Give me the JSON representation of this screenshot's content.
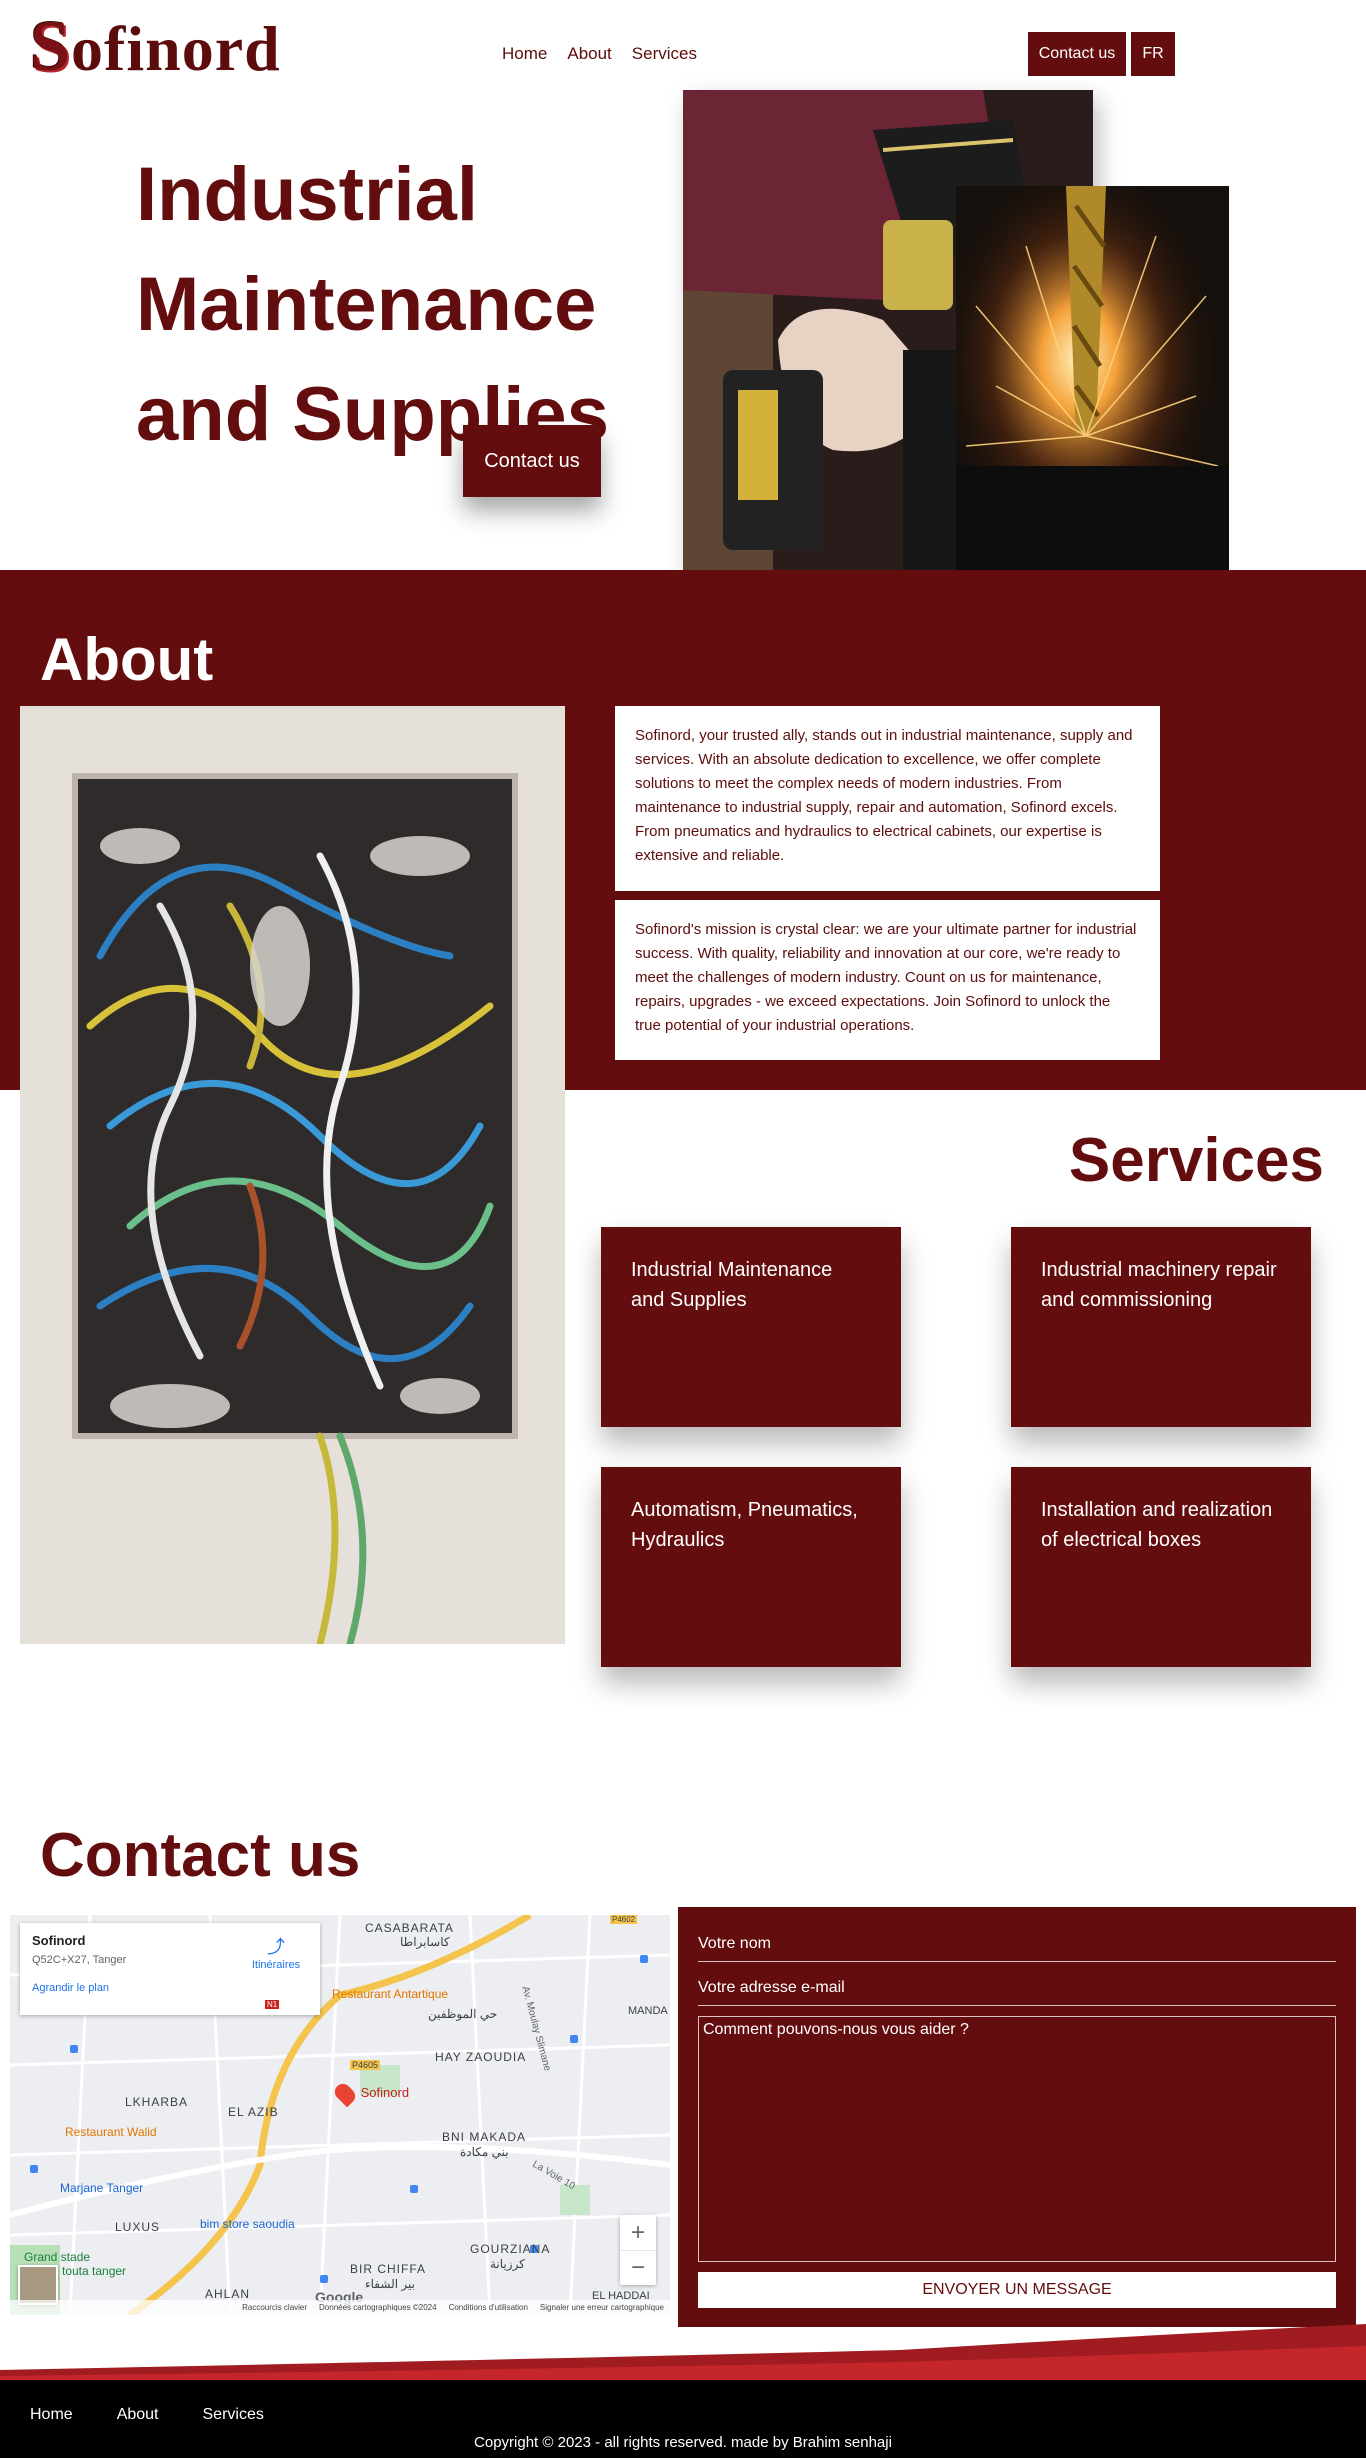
{
  "header": {
    "logo_initial": "S",
    "logo_rest": "ofinord",
    "nav": [
      "Home",
      "About",
      "Services"
    ],
    "contact_button": "Contact us",
    "language_button": "FR"
  },
  "hero": {
    "title_lines": [
      "Industrial",
      "Maintenance",
      "and Supplies"
    ],
    "cta": "Contact us"
  },
  "about": {
    "title": "About",
    "paragraphs": [
      "Sofinord, your trusted ally, stands out in industrial maintenance, supply and services. With an absolute dedication to excellence, we offer complete solutions to meet the complex needs of modern industries. From maintenance to industrial supply, repair and automation, Sofinord excels. From pneumatics and hydraulics to electrical cabinets, our expertise is extensive and reliable.",
      "Sofinord's mission is crystal clear: we are your ultimate partner for industrial success. With quality, reliability and innovation at our core, we're ready to meet the challenges of modern industry. Count on us for maintenance, repairs, upgrades - we exceed expectations. Join Sofinord to unlock the true potential of your industrial operations."
    ]
  },
  "services": {
    "title": "Services",
    "items": [
      "Industrial Maintenance and Supplies",
      "Industrial machinery repair and commissioning",
      "Automatism, Pneumatics, Hydraulics",
      "Installation and realization of electrical boxes"
    ]
  },
  "contact": {
    "title": "Contact us",
    "map": {
      "place_name": "Sofinord",
      "address": "Q52C+X27, Tanger",
      "directions": "Itinéraires",
      "enlarge": "Agrandir le plan",
      "marker_label": "Sofinord",
      "labels": [
        "CASABARATA",
        "كاسابراطا",
        "Restaurant Antartique",
        "حي الموظفين",
        "HAY ZAOUDIA",
        "P4605",
        "LKHARBA",
        "EL AZIB",
        "BNI MAKADA",
        "بني مكادة",
        "Restaurant Walid",
        "Marjane Tanger",
        "LUXUS",
        "bim store saoudia",
        "GOURZIANA",
        "كرزيانة",
        "BIR CHIFFA",
        "بير الشفاء",
        "AHLAN",
        "Grand stade",
        "touta tanger",
        "EL HADDAI",
        "MANDA",
        "Av. Moulay Slimane",
        "La Voie 10",
        "N1",
        "P4602"
      ],
      "footer_items": [
        "Raccourcis clavier",
        "Données cartographiques ©2024",
        "Conditions d'utilisation",
        "Signaler une erreur cartographique"
      ],
      "zoom_in": "+",
      "zoom_out": "−",
      "google_logo": "Google"
    },
    "form": {
      "name_placeholder": "Votre nom",
      "email_placeholder": "Votre adresse e-mail",
      "message_placeholder": "Comment pouvons-nous vous aider ?",
      "submit": "ENVOYER UN MESSAGE"
    }
  },
  "footer": {
    "nav": [
      "Home",
      "About",
      "Services"
    ],
    "copyright": "Copyright © 2023 - all rights reserved. made by Brahim senhaji"
  },
  "colors": {
    "brand": "#640d0e",
    "brand_text": "#5d0c0d",
    "footer_bg": "#000000",
    "wave_red": "#a01c20"
  }
}
